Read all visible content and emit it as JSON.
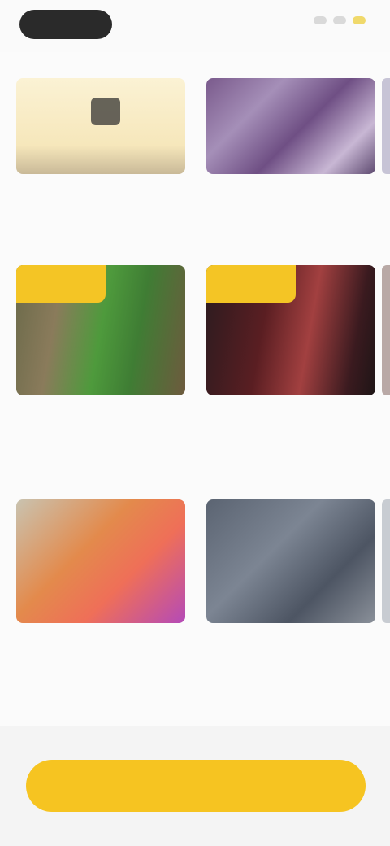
{
  "status_bar": {
    "left_pill": "",
    "icons": [
      "signal-icon",
      "wifi-icon",
      "battery-icon"
    ]
  },
  "sections": [
    {
      "title": "",
      "cards": [
        {
          "title": "",
          "subtitle": ""
        },
        {
          "title": "",
          "subtitle": ""
        }
      ]
    },
    {
      "title": "",
      "cards": [
        {
          "title": "",
          "subtitle": ""
        },
        {
          "title": "",
          "subtitle": ""
        }
      ]
    },
    {
      "title": "",
      "cards": [
        {
          "title": "",
          "subtitle": ""
        },
        {
          "title": "",
          "subtitle": ""
        }
      ]
    }
  ],
  "cta": {
    "label": ""
  },
  "colors": {
    "accent": "#f6c421",
    "background": "#fbfbfb"
  }
}
